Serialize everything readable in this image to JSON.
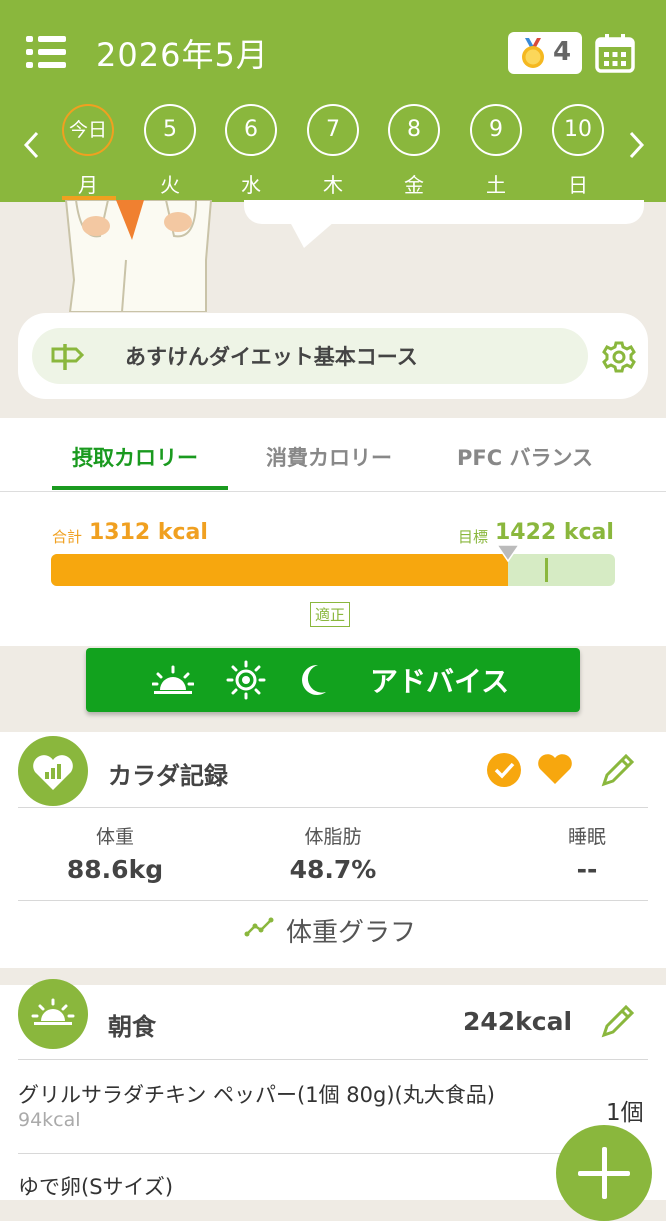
{
  "header": {
    "month_title": "2026年5月",
    "medal_count": "4",
    "days": [
      {
        "num": "今日",
        "weekday": "月",
        "today": true
      },
      {
        "num": "5",
        "weekday": "火"
      },
      {
        "num": "6",
        "weekday": "水"
      },
      {
        "num": "7",
        "weekday": "木"
      },
      {
        "num": "8",
        "weekday": "金"
      },
      {
        "num": "9",
        "weekday": "土"
      },
      {
        "num": "10",
        "weekday": "日"
      }
    ]
  },
  "course": {
    "name": "あすけんダイエット基本コース"
  },
  "calorie": {
    "tabs": [
      "摂取カロリー",
      "消費カロリー",
      "PFC バランス"
    ],
    "total_label": "合計",
    "total_value": "1312 kcal",
    "target_label": "目標",
    "target_value": "1422 kcal",
    "intake_ratio": 0.81,
    "status": "適正"
  },
  "advice": {
    "label": "アドバイス"
  },
  "body_record": {
    "title": "カラダ記録",
    "metrics": [
      {
        "label": "体重",
        "value": "88.6kg"
      },
      {
        "label": "体脂肪",
        "value": "48.7%"
      },
      {
        "label": "睡眠",
        "value": "--"
      }
    ],
    "graph_link": "体重グラフ"
  },
  "breakfast": {
    "title": "朝食",
    "kcal": "242kcal",
    "items": [
      {
        "name": "グリルサラダチキン ペッパー(1個 80g)(丸大食品)",
        "kcal": "94kcal",
        "qty": "1個"
      },
      {
        "name": "ゆで卵(Sサイズ)",
        "kcal": "",
        "qty": ""
      }
    ]
  },
  "colors": {
    "brand_green": "#8ab73d",
    "accent_orange": "#f7a70e",
    "advice_green": "#12a21e"
  }
}
